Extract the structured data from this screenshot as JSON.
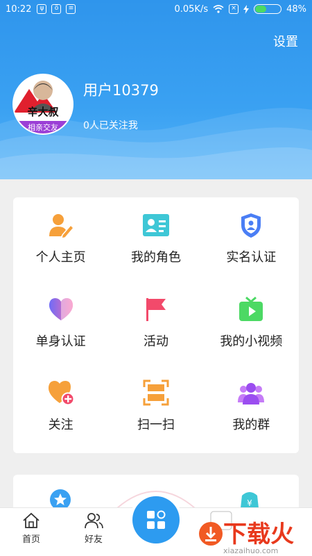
{
  "status_bar": {
    "time": "10:22",
    "net_speed": "0.05K/s",
    "battery": "48%",
    "battery_level": 0.48
  },
  "header": {
    "settings_label": "设置",
    "username": "用户10379",
    "followers_text": "0人已关注我",
    "avatar_text_top": "辛大叔",
    "avatar_text_bottom": "相亲交友"
  },
  "menu": {
    "items": [
      {
        "label": "个人主页",
        "icon": "user-edit-icon"
      },
      {
        "label": "我的角色",
        "icon": "id-card-icon"
      },
      {
        "label": "实名认证",
        "icon": "shield-user-icon"
      },
      {
        "label": "单身认证",
        "icon": "heart-icon"
      },
      {
        "label": "活动",
        "icon": "flag-icon"
      },
      {
        "label": "我的小视频",
        "icon": "tv-play-icon"
      },
      {
        "label": "关注",
        "icon": "heart-plus-icon"
      },
      {
        "label": "扫一扫",
        "icon": "scan-icon"
      },
      {
        "label": "我的群",
        "icon": "group-icon"
      }
    ]
  },
  "tabbar": {
    "home": "首页",
    "friends": "好友"
  },
  "watermark": {
    "brand": "下载火",
    "domain": "xiazaihuo.com"
  },
  "colors": {
    "header_blue": "#2f95ec",
    "orange": "#f6a03a",
    "teal": "#3ec7d6",
    "blue": "#4a7ef5",
    "pink": "#f24a6b",
    "green": "#4cd964",
    "purple": "#9b4df0"
  }
}
